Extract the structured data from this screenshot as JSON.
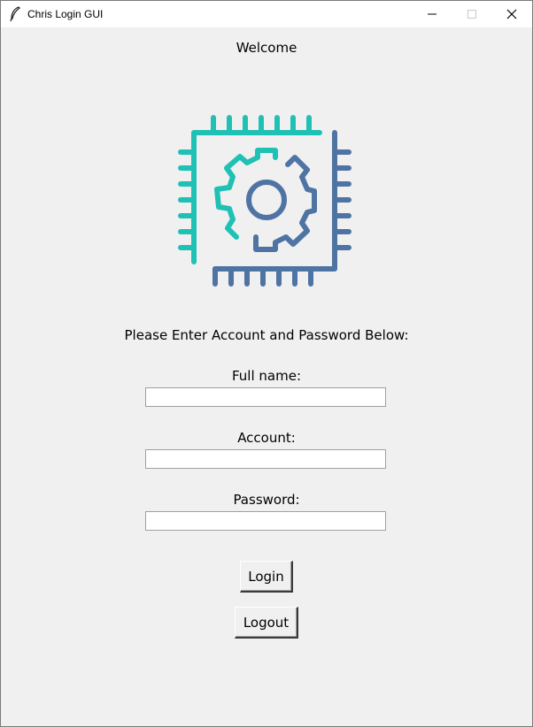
{
  "window": {
    "title": "Chris Login GUI",
    "controls": [
      "minimize",
      "maximize",
      "close"
    ]
  },
  "header": {
    "welcome": "Welcome"
  },
  "logo": {
    "icon": "gear-chip-icon",
    "colors": {
      "teal": "#1fc1b4",
      "blue": "#4f74a4"
    }
  },
  "form": {
    "prompt": "Please Enter Account and Password Below:",
    "fields": [
      {
        "label": "Full name:",
        "value": ""
      },
      {
        "label": "Account:",
        "value": ""
      },
      {
        "label": "Password:",
        "value": ""
      }
    ],
    "login_label": "Login",
    "logout_label": "Logout"
  }
}
